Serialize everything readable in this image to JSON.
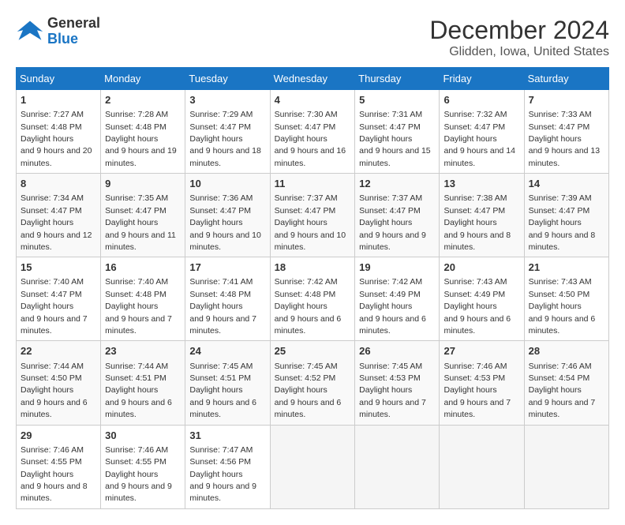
{
  "header": {
    "logo_line1": "General",
    "logo_line2": "Blue",
    "month": "December 2024",
    "location": "Glidden, Iowa, United States"
  },
  "days_of_week": [
    "Sunday",
    "Monday",
    "Tuesday",
    "Wednesday",
    "Thursday",
    "Friday",
    "Saturday"
  ],
  "weeks": [
    [
      {
        "day": "1",
        "sunrise": "7:27 AM",
        "sunset": "4:48 PM",
        "daylight": "9 hours and 20 minutes."
      },
      {
        "day": "2",
        "sunrise": "7:28 AM",
        "sunset": "4:48 PM",
        "daylight": "9 hours and 19 minutes."
      },
      {
        "day": "3",
        "sunrise": "7:29 AM",
        "sunset": "4:47 PM",
        "daylight": "9 hours and 18 minutes."
      },
      {
        "day": "4",
        "sunrise": "7:30 AM",
        "sunset": "4:47 PM",
        "daylight": "9 hours and 16 minutes."
      },
      {
        "day": "5",
        "sunrise": "7:31 AM",
        "sunset": "4:47 PM",
        "daylight": "9 hours and 15 minutes."
      },
      {
        "day": "6",
        "sunrise": "7:32 AM",
        "sunset": "4:47 PM",
        "daylight": "9 hours and 14 minutes."
      },
      {
        "day": "7",
        "sunrise": "7:33 AM",
        "sunset": "4:47 PM",
        "daylight": "9 hours and 13 minutes."
      }
    ],
    [
      {
        "day": "8",
        "sunrise": "7:34 AM",
        "sunset": "4:47 PM",
        "daylight": "9 hours and 12 minutes."
      },
      {
        "day": "9",
        "sunrise": "7:35 AM",
        "sunset": "4:47 PM",
        "daylight": "9 hours and 11 minutes."
      },
      {
        "day": "10",
        "sunrise": "7:36 AM",
        "sunset": "4:47 PM",
        "daylight": "9 hours and 10 minutes."
      },
      {
        "day": "11",
        "sunrise": "7:37 AM",
        "sunset": "4:47 PM",
        "daylight": "9 hours and 10 minutes."
      },
      {
        "day": "12",
        "sunrise": "7:37 AM",
        "sunset": "4:47 PM",
        "daylight": "9 hours and 9 minutes."
      },
      {
        "day": "13",
        "sunrise": "7:38 AM",
        "sunset": "4:47 PM",
        "daylight": "9 hours and 8 minutes."
      },
      {
        "day": "14",
        "sunrise": "7:39 AM",
        "sunset": "4:47 PM",
        "daylight": "9 hours and 8 minutes."
      }
    ],
    [
      {
        "day": "15",
        "sunrise": "7:40 AM",
        "sunset": "4:47 PM",
        "daylight": "9 hours and 7 minutes."
      },
      {
        "day": "16",
        "sunrise": "7:40 AM",
        "sunset": "4:48 PM",
        "daylight": "9 hours and 7 minutes."
      },
      {
        "day": "17",
        "sunrise": "7:41 AM",
        "sunset": "4:48 PM",
        "daylight": "9 hours and 7 minutes."
      },
      {
        "day": "18",
        "sunrise": "7:42 AM",
        "sunset": "4:48 PM",
        "daylight": "9 hours and 6 minutes."
      },
      {
        "day": "19",
        "sunrise": "7:42 AM",
        "sunset": "4:49 PM",
        "daylight": "9 hours and 6 minutes."
      },
      {
        "day": "20",
        "sunrise": "7:43 AM",
        "sunset": "4:49 PM",
        "daylight": "9 hours and 6 minutes."
      },
      {
        "day": "21",
        "sunrise": "7:43 AM",
        "sunset": "4:50 PM",
        "daylight": "9 hours and 6 minutes."
      }
    ],
    [
      {
        "day": "22",
        "sunrise": "7:44 AM",
        "sunset": "4:50 PM",
        "daylight": "9 hours and 6 minutes."
      },
      {
        "day": "23",
        "sunrise": "7:44 AM",
        "sunset": "4:51 PM",
        "daylight": "9 hours and 6 minutes."
      },
      {
        "day": "24",
        "sunrise": "7:45 AM",
        "sunset": "4:51 PM",
        "daylight": "9 hours and 6 minutes."
      },
      {
        "day": "25",
        "sunrise": "7:45 AM",
        "sunset": "4:52 PM",
        "daylight": "9 hours and 6 minutes."
      },
      {
        "day": "26",
        "sunrise": "7:45 AM",
        "sunset": "4:53 PM",
        "daylight": "9 hours and 7 minutes."
      },
      {
        "day": "27",
        "sunrise": "7:46 AM",
        "sunset": "4:53 PM",
        "daylight": "9 hours and 7 minutes."
      },
      {
        "day": "28",
        "sunrise": "7:46 AM",
        "sunset": "4:54 PM",
        "daylight": "9 hours and 7 minutes."
      }
    ],
    [
      {
        "day": "29",
        "sunrise": "7:46 AM",
        "sunset": "4:55 PM",
        "daylight": "9 hours and 8 minutes."
      },
      {
        "day": "30",
        "sunrise": "7:46 AM",
        "sunset": "4:55 PM",
        "daylight": "9 hours and 9 minutes."
      },
      {
        "day": "31",
        "sunrise": "7:47 AM",
        "sunset": "4:56 PM",
        "daylight": "9 hours and 9 minutes."
      },
      null,
      null,
      null,
      null
    ]
  ]
}
